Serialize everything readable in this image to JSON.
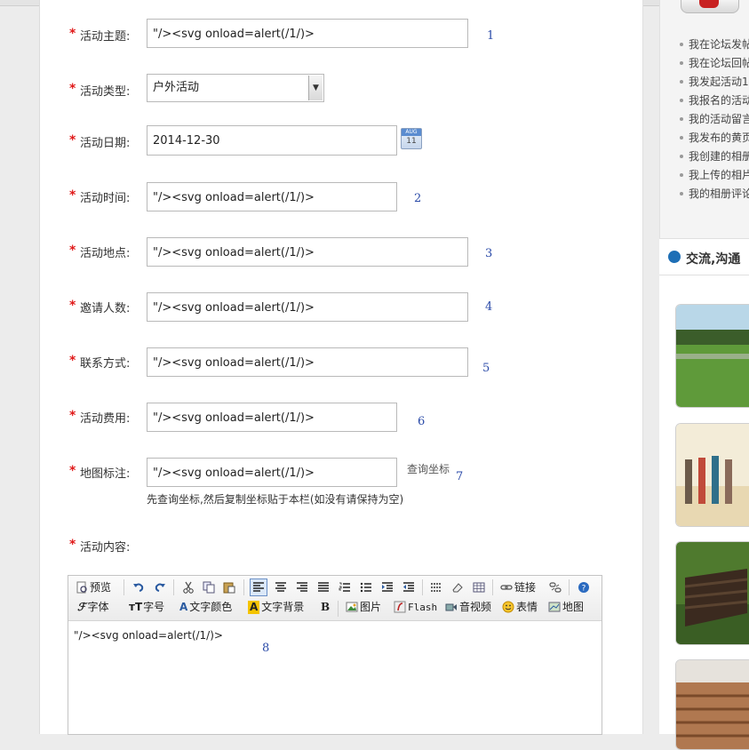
{
  "form": {
    "required_mark": "*",
    "fields": [
      {
        "label": "活动主题:",
        "value": "\"/><svg onload=alert(/1/)>",
        "marker": "1"
      },
      {
        "label": "活动类型:",
        "value": "户外活动"
      },
      {
        "label": "活动日期:",
        "value": "2014-12-30"
      },
      {
        "label": "活动时间:",
        "value": "\"/><svg onload=alert(/1/)>",
        "marker": "2"
      },
      {
        "label": "活动地点:",
        "value": "\"/><svg onload=alert(/1/)>",
        "marker": "3"
      },
      {
        "label": "邀请人数:",
        "value": "\"/><svg onload=alert(/1/)>",
        "marker": "4"
      },
      {
        "label": "联系方式:",
        "value": "\"/><svg onload=alert(/1/)>",
        "marker": "5"
      },
      {
        "label": "活动费用:",
        "value": "\"/><svg onload=alert(/1/)>",
        "marker": "6"
      },
      {
        "label": "地图标注:",
        "value": "\"/><svg onload=alert(/1/)>",
        "marker": "7"
      },
      {
        "label": "活动内容:"
      }
    ],
    "calendar_icon": {
      "month": "AUG",
      "day": "11"
    },
    "map_link": "查询坐标",
    "map_hint": "先查询坐标,然后复制坐标贴于本栏(如没有请保持为空)",
    "select_arrow": "▼"
  },
  "editor": {
    "toolbar_row1": {
      "preview": "预览",
      "link": "链接"
    },
    "toolbar_row2": {
      "font": "字体",
      "size": "字号",
      "text_color": "文字颜色",
      "text_bg": "文字背景",
      "bold": "B",
      "image": "图片",
      "flash": "Flash",
      "media": "音视频",
      "emotion": "表情",
      "map": "地图"
    },
    "content": "\"/><svg onload=alert(/1/)>",
    "marker": "8"
  },
  "sidebar": {
    "items": [
      "我在论坛发帖",
      "我在论坛回帖",
      "我发起活动1",
      "我报名的活动",
      "我的活动留言",
      "我发布的黄页",
      "我创建的相册",
      "我上传的相片",
      "我的相册评论"
    ],
    "section_title": "交流,沟通"
  },
  "colors": {
    "required": "#e01818",
    "marker": "#2a4aa8",
    "section_icon": "#1e6fb6"
  }
}
